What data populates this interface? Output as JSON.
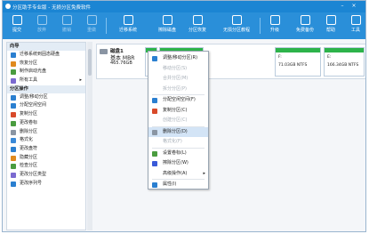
{
  "title": "分区助手专业版 - 无损分区免费软件",
  "toolbar": {
    "items": [
      {
        "label": "提交",
        "icon": "check-icon",
        "dim": false
      },
      {
        "label": "放弃",
        "icon": "undo-icon",
        "dim": true
      },
      {
        "label": "撤销",
        "icon": "undo-arrow-icon",
        "dim": true
      },
      {
        "label": "重做",
        "icon": "redo-arrow-icon",
        "dim": true
      },
      {
        "label": "迁移系统",
        "icon": "migrate-icon",
        "dim": false
      },
      {
        "label": "擦除磁盘",
        "icon": "erase-icon",
        "dim": false
      },
      {
        "label": "分区恢复",
        "icon": "restore-icon",
        "dim": false
      },
      {
        "label": "无损分区教程",
        "icon": "tutorial-icon",
        "dim": false
      },
      {
        "label": "升级",
        "icon": "upgrade-icon",
        "dim": false
      },
      {
        "label": "免费备份",
        "icon": "backup-icon",
        "dim": false
      },
      {
        "label": "帮助",
        "icon": "help-icon",
        "dim": false
      },
      {
        "label": "工具",
        "icon": "tools-icon",
        "dim": false
      }
    ]
  },
  "sidebar": {
    "wizard_header": "向导",
    "wizard_items": [
      {
        "label": "迁移系统到固态硬盘",
        "color": "#2a7fd0"
      },
      {
        "label": "恢复分区",
        "color": "#e08a1e"
      },
      {
        "label": "制作启动光盘",
        "color": "#4a9c3f"
      },
      {
        "label": "所有工具",
        "color": "#7b6ad0",
        "arrow": "▸"
      }
    ],
    "ops_header": "分区操作",
    "ops_items": [
      {
        "label": "调整/移动分区",
        "color": "#2a7fd0"
      },
      {
        "label": "分配空闲空间",
        "color": "#2a7fd0"
      },
      {
        "label": "复制分区",
        "color": "#d84a2a"
      },
      {
        "label": "更改卷标",
        "color": "#4a9c3f"
      },
      {
        "label": "删除分区",
        "color": "#8a95a3"
      },
      {
        "label": "格式化",
        "color": "#3a8ad8"
      },
      {
        "label": "更改盘符",
        "color": "#2a7fd0"
      },
      {
        "label": "隐藏分区",
        "color": "#e08a1e"
      },
      {
        "label": "检查分区",
        "color": "#4a9c3f"
      },
      {
        "label": "更改分区类型",
        "color": "#7b6ad0"
      },
      {
        "label": "更改序列号",
        "color": "#2a7fd0"
      }
    ]
  },
  "disk": {
    "name": "磁盘1",
    "type": "基本 MBR",
    "size": "465.76GB",
    "partitions": [
      {
        "label": "C:",
        "size": "",
        "color": "#2db34a"
      },
      {
        "label": "",
        "size": "",
        "color": "#2db34a"
      },
      {
        "label": "F:",
        "size": "71.03GB NTFS",
        "color": "#2db34a"
      },
      {
        "label": "E:",
        "size": "166.34GB NTFS",
        "color": "#2db34a"
      }
    ]
  },
  "context_menu": {
    "items": [
      {
        "label": "调整/移动分区(R)",
        "icon": "resize-icon",
        "color": "#2a7fd0",
        "state": "normal"
      },
      {
        "label": "移动分区(S)",
        "state": "disabled"
      },
      {
        "label": "合并分区(M)",
        "state": "disabled"
      },
      {
        "label": "拆分分区(P)",
        "state": "disabled"
      },
      {
        "label": "分配空闲空间(F)",
        "icon": "allocate-icon",
        "color": "#2a7fd0",
        "state": "normal"
      },
      {
        "label": "复制分区(C)",
        "icon": "copy-icon",
        "color": "#d84a2a",
        "state": "normal"
      },
      {
        "label": "创建分区(C)",
        "state": "disabled"
      },
      {
        "label": "删除分区(D)",
        "icon": "delete-icon",
        "color": "#8a95a3",
        "state": "highlighted"
      },
      {
        "label": "格式化(F)",
        "state": "disabled"
      },
      {
        "label": "设置卷标(L)",
        "icon": "label-icon",
        "color": "#4a9c3f",
        "state": "normal"
      },
      {
        "label": "擦除分区(W)",
        "icon": "wipe-icon",
        "color": "#3a5ad8",
        "state": "normal"
      },
      {
        "label": "高级操作(A)",
        "state": "normal",
        "arrow": "▸"
      },
      {
        "label": "属性(I)",
        "icon": "info-icon",
        "color": "#2a7fd0",
        "state": "normal"
      }
    ]
  }
}
